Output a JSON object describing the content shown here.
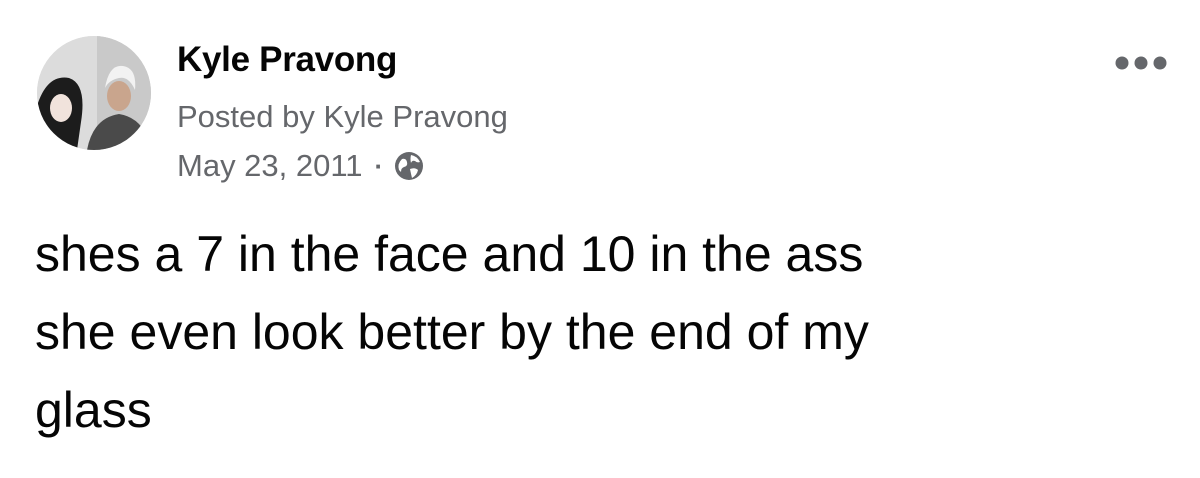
{
  "post": {
    "author_name": "Kyle Pravong",
    "posted_by": "Posted by Kyle Pravong",
    "date": "May 23, 2011",
    "separator": "·",
    "privacy_icon": "globe-icon",
    "more_icon": "more-options-icon",
    "text_lines": [
      "shes a 7 in the face and 10 in the ass",
      "she even look better by the end of my",
      "glass"
    ]
  },
  "colors": {
    "primary_text": "#050505",
    "secondary_text": "#65676b"
  }
}
